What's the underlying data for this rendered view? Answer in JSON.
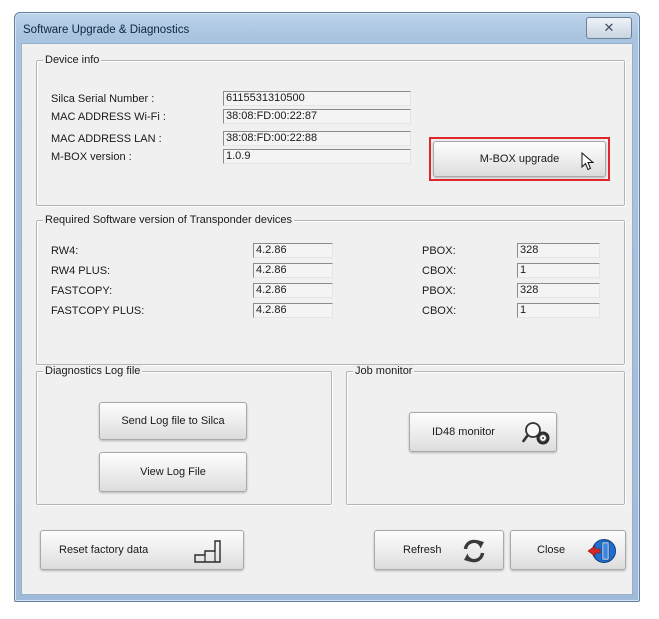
{
  "window": {
    "title": "Software Upgrade & Diagnostics",
    "close_glyph": "✕"
  },
  "device_info": {
    "legend": "Device info",
    "serial_label": "Silca Serial Number :",
    "serial_value": "6115531310500",
    "mac_wifi_label": "MAC ADDRESS Wi-Fi :",
    "mac_wifi_value": "38:08:FD:00:22:87",
    "mac_lan_label": "MAC ADDRESS LAN :",
    "mac_lan_value": "38:08:FD:00:22:88",
    "mbox_version_label": "M-BOX version :",
    "mbox_version_value": "1.0.9",
    "upgrade_button": "M-BOX upgrade"
  },
  "required_software": {
    "legend": "Required Software version of Transponder devices",
    "rows": [
      {
        "label": "RW4:",
        "value": "4.2.86",
        "box_label": "PBOX:",
        "box_value": "328"
      },
      {
        "label": "RW4 PLUS:",
        "value": "4.2.86",
        "box_label": "CBOX:",
        "box_value": "1"
      },
      {
        "label": "FASTCOPY:",
        "value": "4.2.86",
        "box_label": "PBOX:",
        "box_value": "328"
      },
      {
        "label": "FASTCOPY PLUS:",
        "value": "4.2.86",
        "box_label": "CBOX:",
        "box_value": "1"
      }
    ]
  },
  "diagnostics": {
    "legend": "Diagnostics Log file",
    "send_button": "Send Log file to Silca",
    "view_button": "View Log File"
  },
  "job_monitor": {
    "legend": "Job monitor",
    "id48_button": "ID48 monitor"
  },
  "footer": {
    "reset_button": "Reset factory data",
    "refresh_button": "Refresh",
    "close_button": "Close"
  },
  "colors": {
    "highlight": "#e0262c",
    "refresh_icon": "#3a3a3a",
    "close_icon_blue": "#1e6fd0"
  }
}
